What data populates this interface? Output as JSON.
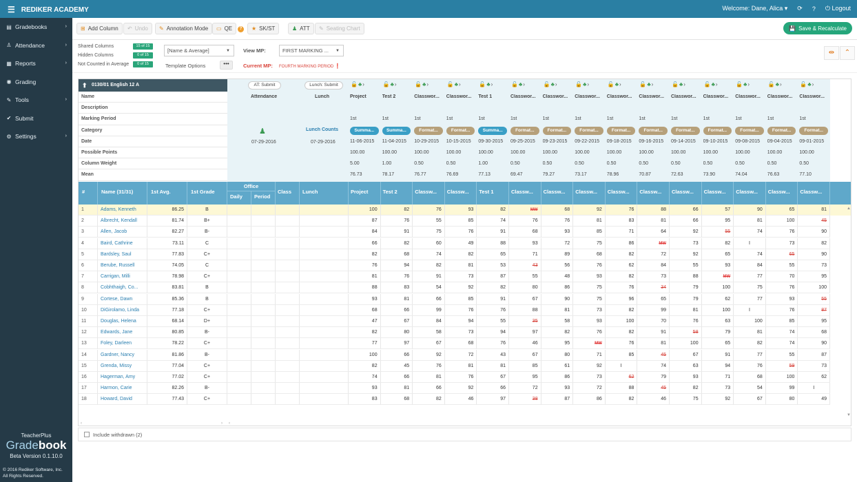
{
  "app": {
    "brand": "REDIKER ACADEMY",
    "welcome": "Welcome: Dane, Alica",
    "logout": "Logout"
  },
  "sidebar": {
    "items": [
      {
        "label": "Gradebooks",
        "icon": "book-icon",
        "chev": true
      },
      {
        "label": "Attendance",
        "icon": "person-icon",
        "chev": true
      },
      {
        "label": "Reports",
        "icon": "document-icon",
        "chev": true
      },
      {
        "label": "Grading",
        "icon": "circle-icon",
        "chev": false
      },
      {
        "label": "Tools",
        "icon": "wrench-icon",
        "chev": true
      },
      {
        "label": "Submit",
        "icon": "check-icon",
        "chev": false
      },
      {
        "label": "Settings",
        "icon": "gear-icon",
        "chev": true
      }
    ],
    "footer": {
      "product_line": "TeacherPlus",
      "product_a": "Grade",
      "product_b": "book",
      "version": "Beta Version 0.1.10.0",
      "copyright1": "© 2016 Rediker Software, Inc.",
      "copyright2": "All Rights Reserved."
    }
  },
  "toolbar": {
    "add_column": "Add Column",
    "undo": "Undo",
    "annotation_mode": "Annotation Mode",
    "qe": "QE",
    "sk_st": "SK/ST",
    "att": "ATT",
    "seating_chart": "Seating Chart",
    "save": "Save & Recalculate"
  },
  "options": {
    "shared_columns": "Shared Columns",
    "shared_badge": "15 of 15",
    "hidden_columns": "Hidden Columns",
    "hidden_badge": "0 of 15",
    "not_counted": "Not Counted in Average",
    "not_counted_badge": "0 of 15",
    "name_select": "[Name & Average]",
    "template_options": "Template Options",
    "template_btn": "•••",
    "view_mp_label": "View MP:",
    "view_mp_value": "FIRST MARKING ...",
    "current_mp_label": "Current MP:",
    "current_mp_value": "FOURTH MARKING PERIOD"
  },
  "grid": {
    "class_title": "0130/01 English 12 A",
    "labels": [
      "Name",
      "Description",
      "Marking Period",
      "Category",
      "Date",
      "Possible Points",
      "Column Weight",
      "Mean"
    ],
    "attendance": {
      "submit": "AT: Submit",
      "title": "Attendance",
      "date": "07-29-2016"
    },
    "lunch": {
      "submit": "Lunch: Submit",
      "title": "Lunch",
      "counts": "Lunch Counts",
      "date": "07-29-2016"
    },
    "columns": [
      {
        "name": "Project",
        "mp": "1st",
        "cat": "Summa...",
        "type": "s",
        "date": "11-06-2015",
        "pts": "100.00",
        "wt": "5.00",
        "mean": "76.73",
        "short": "Project"
      },
      {
        "name": "Test 2",
        "mp": "1st",
        "cat": "Summa...",
        "type": "s",
        "date": "11-04-2015",
        "pts": "100.00",
        "wt": "1.00",
        "mean": "78.17",
        "short": "Test 2"
      },
      {
        "name": "Classwor...",
        "mp": "1st",
        "cat": "Format...",
        "type": "f",
        "date": "10-29-2015",
        "pts": "100.00",
        "wt": "0.50",
        "mean": "76.77",
        "short": "Classw..."
      },
      {
        "name": "Classwor...",
        "mp": "1st",
        "cat": "Format...",
        "type": "f",
        "date": "10-15-2015",
        "pts": "100.00",
        "wt": "0.50",
        "mean": "76.69",
        "short": "Classw..."
      },
      {
        "name": "Test 1",
        "mp": "1st",
        "cat": "Summa...",
        "type": "s",
        "date": "09-30-2015",
        "pts": "100.00",
        "wt": "1.00",
        "mean": "77.13",
        "short": "Test 1"
      },
      {
        "name": "Classwor...",
        "mp": "1st",
        "cat": "Format...",
        "type": "f",
        "date": "09-25-2015",
        "pts": "100.00",
        "wt": "0.50",
        "mean": "69.47",
        "short": "Classw..."
      },
      {
        "name": "Classwor...",
        "mp": "1st",
        "cat": "Format...",
        "type": "f",
        "date": "09-23-2015",
        "pts": "100.00",
        "wt": "0.50",
        "mean": "79.27",
        "short": "Classw..."
      },
      {
        "name": "Classwor...",
        "mp": "1st",
        "cat": "Format...",
        "type": "f",
        "date": "09-22-2015",
        "pts": "100.00",
        "wt": "0.50",
        "mean": "73.17",
        "short": "Classw..."
      },
      {
        "name": "Classwor...",
        "mp": "1st",
        "cat": "Format...",
        "type": "f",
        "date": "09-18-2015",
        "pts": "100.00",
        "wt": "0.50",
        "mean": "78.96",
        "short": "Classw..."
      },
      {
        "name": "Classwor...",
        "mp": "1st",
        "cat": "Format...",
        "type": "f",
        "date": "09-16-2015",
        "pts": "100.00",
        "wt": "0.50",
        "mean": "70.87",
        "short": "Classw..."
      },
      {
        "name": "Classwor...",
        "mp": "1st",
        "cat": "Format...",
        "type": "f",
        "date": "09-14-2015",
        "pts": "100.00",
        "wt": "0.50",
        "mean": "72.63",
        "short": "Classw..."
      },
      {
        "name": "Classwor...",
        "mp": "1st",
        "cat": "Format...",
        "type": "f",
        "date": "09-10-2015",
        "pts": "100.00",
        "wt": "0.50",
        "mean": "73.90",
        "short": "Classw..."
      },
      {
        "name": "Classwor...",
        "mp": "1st",
        "cat": "Format...",
        "type": "f",
        "date": "09-08-2015",
        "pts": "100.00",
        "wt": "0.50",
        "mean": "74.04",
        "short": "Classw..."
      },
      {
        "name": "Classwor...",
        "mp": "1st",
        "cat": "Format...",
        "type": "f",
        "date": "09-04-2015",
        "pts": "100.00",
        "wt": "0.50",
        "mean": "76.63",
        "short": "Classw..."
      },
      {
        "name": "Classwor...",
        "mp": "1st",
        "cat": "Format...",
        "type": "f",
        "date": "09-01-2015",
        "pts": "100.00",
        "wt": "0.50",
        "mean": "77.10",
        "short": "Classw..."
      }
    ],
    "table_headers": {
      "idx": "#",
      "name": "Name (31/31)",
      "avg": "1st Avg.",
      "grade": "1st Grade",
      "office": "Office",
      "daily": "Daily",
      "period": "Period",
      "class": "Class",
      "lunch": "Lunch"
    },
    "students": [
      {
        "n": "1",
        "name": "Adams, Kenneth",
        "avg": "86.25",
        "grade": "B",
        "s": [
          "100",
          "82",
          "76",
          "93",
          "82",
          "MW",
          "68",
          "92",
          "76",
          "88",
          "66",
          "57",
          "90",
          "65",
          "81"
        ]
      },
      {
        "n": "2",
        "name": "Albrecht, Kendall",
        "avg": "81.74",
        "grade": "B+",
        "s": [
          "87",
          "76",
          "55",
          "85",
          "74",
          "76",
          "76",
          "81",
          "83",
          "81",
          "66",
          "95",
          "81",
          "100",
          "45"
        ]
      },
      {
        "n": "3",
        "name": "Allen, Jacob",
        "avg": "82.27",
        "grade": "B-",
        "s": [
          "84",
          "91",
          "75",
          "76",
          "91",
          "68",
          "93",
          "85",
          "71",
          "64",
          "92",
          "55",
          "74",
          "76",
          "90"
        ]
      },
      {
        "n": "4",
        "name": "Baird, Cathrine",
        "avg": "73.11",
        "grade": "C",
        "s": [
          "66",
          "82",
          "60",
          "49",
          "88",
          "93",
          "72",
          "75",
          "86",
          "MW",
          "73",
          "82",
          "I",
          "73",
          "82"
        ]
      },
      {
        "n": "5",
        "name": "Bardsley, Saul",
        "avg": "77.83",
        "grade": "C+",
        "s": [
          "82",
          "68",
          "74",
          "82",
          "65",
          "71",
          "89",
          "68",
          "82",
          "72",
          "92",
          "65",
          "74",
          "65",
          "90"
        ]
      },
      {
        "n": "6",
        "name": "Berube, Russell",
        "avg": "74.05",
        "grade": "C",
        "s": [
          "76",
          "94",
          "82",
          "81",
          "53",
          "43",
          "56",
          "76",
          "62",
          "84",
          "55",
          "93",
          "84",
          "55",
          "73"
        ]
      },
      {
        "n": "7",
        "name": "Carrigan, Milli",
        "avg": "78.98",
        "grade": "C+",
        "s": [
          "81",
          "76",
          "91",
          "73",
          "87",
          "55",
          "48",
          "93",
          "82",
          "73",
          "88",
          "MW",
          "77",
          "70",
          "95"
        ]
      },
      {
        "n": "8",
        "name": "Cobhthaigh, Co...",
        "avg": "83.81",
        "grade": "B",
        "s": [
          "88",
          "83",
          "54",
          "92",
          "82",
          "80",
          "86",
          "75",
          "76",
          "34",
          "79",
          "100",
          "75",
          "76",
          "100"
        ]
      },
      {
        "n": "9",
        "name": "Cortese, Dawn",
        "avg": "85.36",
        "grade": "B",
        "s": [
          "93",
          "81",
          "66",
          "85",
          "91",
          "67",
          "90",
          "75",
          "96",
          "65",
          "79",
          "62",
          "77",
          "93",
          "55"
        ]
      },
      {
        "n": "10",
        "name": "DiGirolamo, Linda",
        "avg": "77.18",
        "grade": "C+",
        "s": [
          "68",
          "66",
          "99",
          "76",
          "76",
          "88",
          "81",
          "73",
          "82",
          "99",
          "81",
          "100",
          "I",
          "76",
          "87"
        ]
      },
      {
        "n": "11",
        "name": "Douglas, Helena",
        "avg": "68.14",
        "grade": "D+",
        "s": [
          "47",
          "67",
          "84",
          "94",
          "55",
          "35",
          "58",
          "93",
          "100",
          "70",
          "76",
          "63",
          "100",
          "85",
          "95"
        ]
      },
      {
        "n": "12",
        "name": "Edwards, Jane",
        "avg": "80.85",
        "grade": "B-",
        "s": [
          "82",
          "80",
          "58",
          "73",
          "94",
          "97",
          "82",
          "76",
          "82",
          "91",
          "58",
          "79",
          "81",
          "74",
          "68"
        ]
      },
      {
        "n": "13",
        "name": "Foley, Darleen",
        "avg": "78.22",
        "grade": "C+",
        "s": [
          "77",
          "97",
          "67",
          "68",
          "76",
          "46",
          "95",
          "MW",
          "76",
          "81",
          "100",
          "65",
          "82",
          "74",
          "90"
        ]
      },
      {
        "n": "14",
        "name": "Gardner, Nancy",
        "avg": "81.86",
        "grade": "B-",
        "s": [
          "100",
          "66",
          "92",
          "72",
          "43",
          "67",
          "80",
          "71",
          "85",
          "45",
          "67",
          "91",
          "77",
          "55",
          "87"
        ]
      },
      {
        "n": "15",
        "name": "Grenda, Missy",
        "avg": "77.04",
        "grade": "C+",
        "s": [
          "82",
          "45",
          "76",
          "81",
          "81",
          "85",
          "61",
          "92",
          "I",
          "74",
          "63",
          "94",
          "76",
          "59",
          "73"
        ]
      },
      {
        "n": "16",
        "name": "Hagerman, Amy",
        "avg": "77.02",
        "grade": "C+",
        "s": [
          "74",
          "66",
          "81",
          "76",
          "67",
          "95",
          "86",
          "73",
          "62",
          "79",
          "93",
          "71",
          "68",
          "100",
          "62"
        ]
      },
      {
        "n": "17",
        "name": "Harmon, Carie",
        "avg": "82.26",
        "grade": "B-",
        "s": [
          "93",
          "81",
          "66",
          "92",
          "66",
          "72",
          "93",
          "72",
          "88",
          "45",
          "82",
          "73",
          "54",
          "99",
          "I"
        ]
      },
      {
        "n": "18",
        "name": "Howard, David",
        "avg": "77.43",
        "grade": "C+",
        "s": [
          "83",
          "68",
          "82",
          "46",
          "97",
          "38",
          "87",
          "86",
          "82",
          "46",
          "75",
          "92",
          "67",
          "80",
          "49"
        ]
      }
    ],
    "excluded": [
      [
        0,
        5
      ],
      [
        1,
        14
      ],
      [
        2,
        11
      ],
      [
        3,
        9
      ],
      [
        4,
        13
      ],
      [
        5,
        5
      ],
      [
        6,
        11
      ],
      [
        7,
        9
      ],
      [
        8,
        14
      ],
      [
        9,
        14
      ],
      [
        10,
        5
      ],
      [
        11,
        10
      ],
      [
        12,
        7
      ],
      [
        13,
        9
      ],
      [
        14,
        13
      ],
      [
        15,
        8
      ],
      [
        16,
        9
      ],
      [
        17,
        5
      ]
    ]
  },
  "footer": {
    "include_withdrawn": "Include withdrawn (2)"
  }
}
